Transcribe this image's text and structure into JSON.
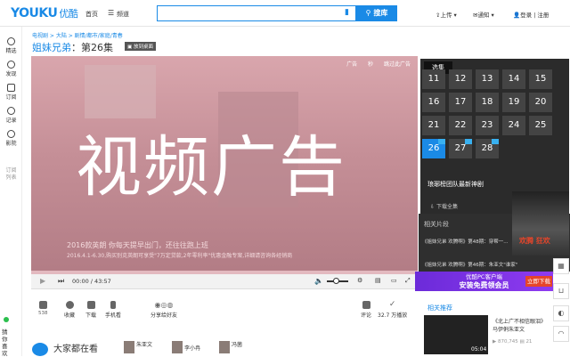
{
  "header": {
    "logo_latin": "YOUKU",
    "logo_cn": "优酷",
    "nav_home": "首页",
    "nav_channel": "频道",
    "search_placeholder": "",
    "search_button": "搜库",
    "upload": "上传",
    "notify": "通知",
    "login": "登录 | 注册"
  },
  "left_rail": {
    "items": [
      {
        "label": "精选",
        "icon": "play-circle-icon"
      },
      {
        "label": "发现",
        "icon": "compass-icon"
      },
      {
        "label": "订阅",
        "icon": "rss-icon"
      },
      {
        "label": "记录",
        "icon": "history-icon"
      },
      {
        "label": "影院",
        "icon": "film-icon"
      },
      {
        "label": "订阅\n列表",
        "icon": "list-icon"
      }
    ],
    "guess": "猜你喜欢"
  },
  "breadcrumb": "电视剧 > 大陆 > 剧情/都市/家庭/青春",
  "title": {
    "show": "姐妹兄弟",
    "episode": "：第26集",
    "desktop_btn": "放到桌面"
  },
  "player": {
    "ad_overlay": "视频广告",
    "ad_tags": [
      "广告",
      "秒",
      "跳过此广告"
    ],
    "caption_line1": "2016款英朗    你每天提早出门，还往往跑上班",
    "caption_line2": "2016.4.1-6.30,购买别克英朗可享受\"7万定贷款,2年零利率\"优惠金融专案,详细请咨询各经销商",
    "time": "00:00 / 43:57"
  },
  "actions": [
    {
      "label": "收藏",
      "count": "538",
      "icon": "thumb-up-icon"
    },
    {
      "label": "收藏",
      "count": "",
      "icon": "star-icon"
    },
    {
      "label": "下载",
      "count": "",
      "icon": "download-icon"
    },
    {
      "label": "手机看",
      "count": "",
      "icon": "phone-icon"
    },
    {
      "label": "分享给好友",
      "count": "",
      "icon": "share-icon"
    },
    {
      "label": "评论",
      "count": "",
      "icon": "comment-icon"
    },
    {
      "label": "32.7 万播放",
      "count": "",
      "icon": "check-icon"
    }
  ],
  "bottom": {
    "heading": "大家都在看",
    "stars": [
      "朱亚文",
      "李小冉",
      "冯菌"
    ]
  },
  "episodes_panel": {
    "tab": "选集",
    "numbers": [
      "11",
      "12",
      "13",
      "14",
      "15",
      "16",
      "17",
      "18",
      "19",
      "20",
      "21",
      "22",
      "23",
      "24",
      "25",
      "26",
      "27",
      "28"
    ],
    "active": "26",
    "special": "琅琊榜团队最新神剧",
    "download_all": "下载全集"
  },
  "related": {
    "head": "相关片段",
    "items": [
      "《姐妹兄弟 欢腾啊》第48期：穿帮一...",
      "《姐妹兄弟 欢腾啊》第46期：朱亚文\"谁家\""
    ]
  },
  "promo": {
    "line1": "优酷PC客户端",
    "line2": "安装免费领会员",
    "button": "立即下载",
    "poster_text": "欢腾 狂欢"
  },
  "recommend": {
    "head": "相关推荐",
    "title": "《北上广不相信眼泪》马伊俐朱亚文",
    "count": "870,745",
    "comments": "21",
    "duration": "05:04"
  },
  "colors": {
    "brand_blue": "#1a8ae6",
    "brand_red": "#e6452a",
    "ad_pink": "#c28f97",
    "panel_dark": "#2b2b2b"
  }
}
